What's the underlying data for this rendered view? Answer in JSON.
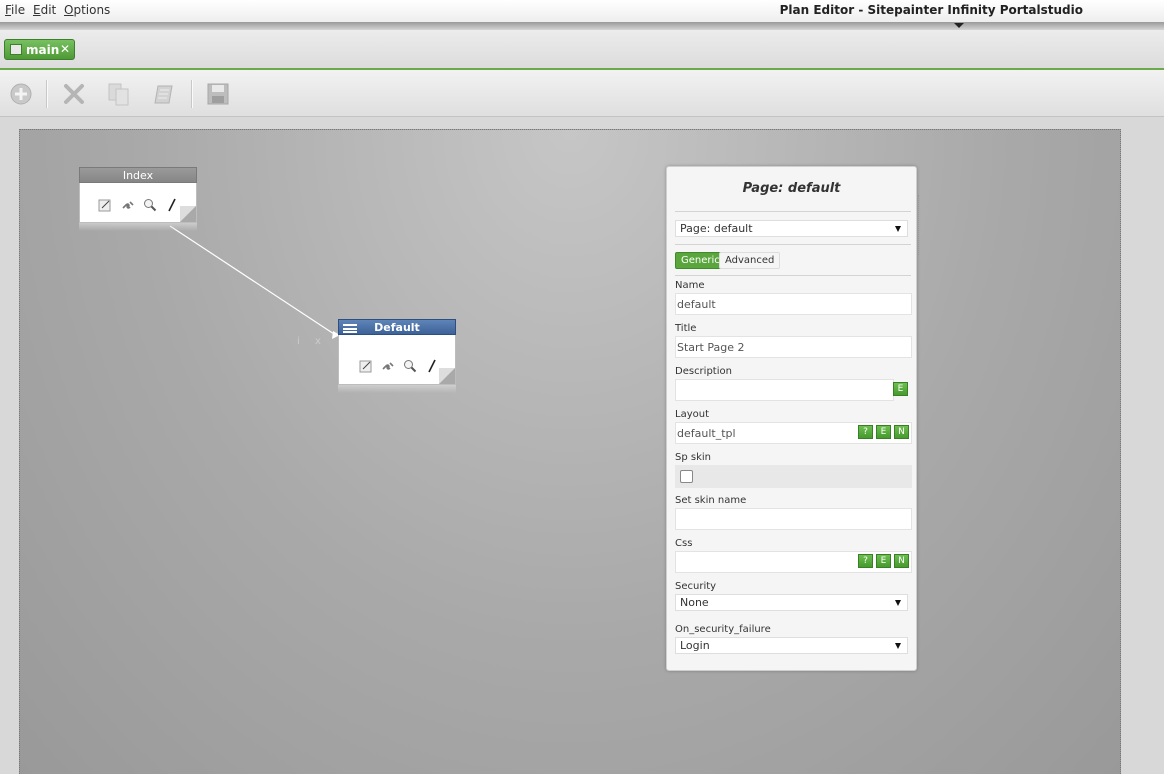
{
  "menubar": {
    "items": [
      "File",
      "Edit",
      "Options"
    ],
    "app_title": "Plan Editor - Sitepainter Infinity Portalstudio"
  },
  "tabs": [
    {
      "label": "main",
      "close": "✕"
    }
  ],
  "toolbar": {
    "buttons": [
      "add-icon",
      "delete-icon",
      "copy-icon",
      "paste-icon",
      "save-icon"
    ]
  },
  "canvas": {
    "nodes": [
      {
        "name": "Index",
        "icons": [
          "edit-icon",
          "link-icon",
          "zoom-icon",
          "pen-icon"
        ]
      },
      {
        "name": "Default",
        "icons": [
          "edit-icon",
          "link-icon",
          "zoom-icon",
          "pen-icon"
        ],
        "side_buttons": [
          "i",
          "x"
        ]
      }
    ]
  },
  "panel": {
    "title": "Page: default",
    "page_select": "Page: default",
    "tabs": [
      "Generic",
      "Advanced"
    ],
    "fields": {
      "name": {
        "label": "Name",
        "value": "default"
      },
      "title": {
        "label": "Title",
        "value": "Start Page 2"
      },
      "description": {
        "label": "Description",
        "value": "",
        "buttons": [
          "E"
        ]
      },
      "layout": {
        "label": "Layout",
        "value": "default_tpl",
        "buttons": [
          "?",
          "E",
          "N"
        ]
      },
      "sp_skin": {
        "label": "Sp skin",
        "checked": false
      },
      "set_skin_name": {
        "label": "Set skin name",
        "value": ""
      },
      "css": {
        "label": "Css",
        "value": "",
        "buttons": [
          "?",
          "E",
          "N"
        ]
      },
      "security": {
        "label": "Security",
        "value": "None"
      },
      "on_security_failure": {
        "label": "On_security_failure",
        "value": "Login"
      }
    }
  },
  "colors": {
    "accent_green": "#5aa63d",
    "node_header_blue": "#3c6299",
    "canvas_gray": "#a9a9a9"
  }
}
